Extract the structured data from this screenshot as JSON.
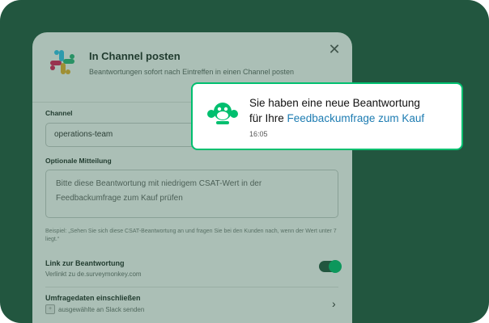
{
  "modal": {
    "title": "In Channel posten",
    "subtitle": "Beantwortungen sofort nach Eintreffen in einen Channel posten",
    "close_icon": "close-icon",
    "channel_label": "Channel",
    "channel_value": "operations-team",
    "message_label": "Optionale Mitteilung",
    "message_value": "Bitte diese Beantwortung mit niedrigem CSAT-Wert in der Feedbackumfrage zum Kauf prüfen",
    "hint": "Beispiel: „Sehen Sie sich diese CSAT-Beantwortung an und fragen Sie bei den Kunden nach, wenn der Wert unter 7 liegt.“",
    "link_title": "Link zur Beantwortung",
    "link_sub": "Verlinkt zu de.surveymonkey.com",
    "link_toggle_on": true,
    "data_title": "Umfragedaten einschließen",
    "data_sub": "ausgewählte an Slack senden"
  },
  "notification": {
    "line1": "Sie haben eine neue Beantwortung",
    "line2_prefix": "für Ihre ",
    "link_text": "Feedbackumfrage zum Kauf",
    "time": "16:05",
    "icon": "surveymonkey-logo-icon"
  },
  "colors": {
    "background": "#23563f",
    "accent_green": "#00bf6f",
    "link_blue": "#1d7cb2"
  }
}
